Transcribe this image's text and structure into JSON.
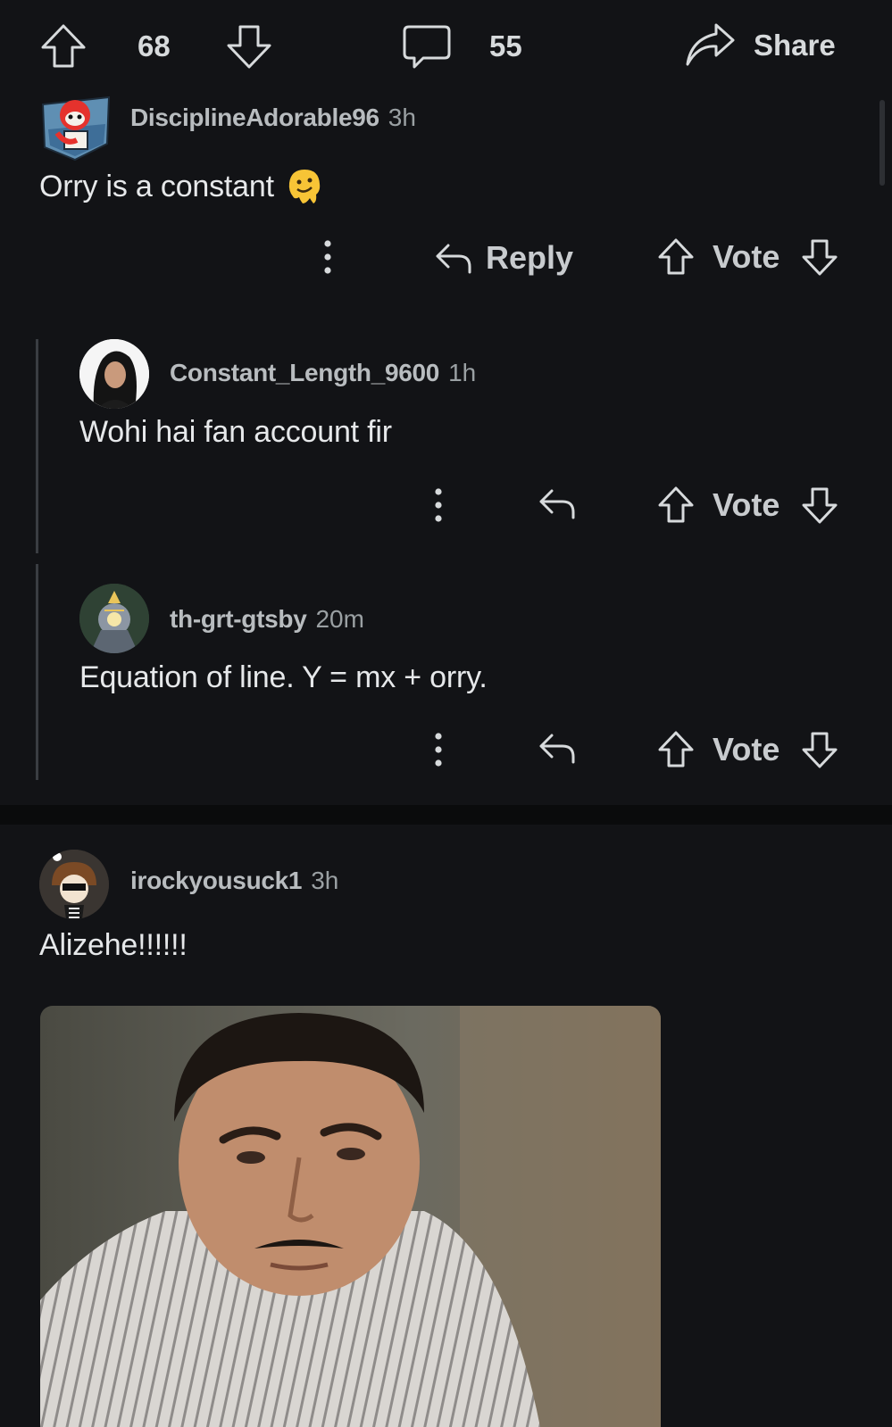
{
  "post_actions": {
    "upvote_count": "68",
    "comment_count": "55",
    "share_label": "Share",
    "icons": [
      "upvote-icon",
      "downvote-icon",
      "comment-icon",
      "share-icon"
    ]
  },
  "comments": [
    {
      "username": "DisciplineAdorable96",
      "time": "3h",
      "body": "Orry is a constant",
      "emoji_icon": "melting-face-emoji",
      "reply_label": "Reply",
      "vote_label": "Vote"
    },
    {
      "username": "Constant_Length_9600",
      "time": "1h",
      "body": "Wohi hai fan account fir",
      "vote_label": "Vote"
    },
    {
      "username": "th-grt-gtsby",
      "time": "20m",
      "body": "Equation of line. Y = mx + orry.",
      "vote_label": "Vote"
    },
    {
      "username": "irockyousuck1",
      "time": "3h",
      "body": "Alizehe!!!!!!",
      "media": "reaction-gif-image"
    }
  ],
  "colors": {
    "background": "#121316",
    "text": "#d7dadc",
    "muted": "#9aa0a3",
    "separator": "#0a0b0c"
  }
}
